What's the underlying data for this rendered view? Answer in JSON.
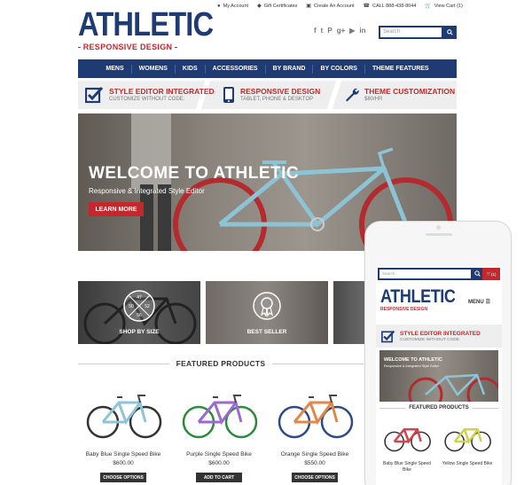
{
  "utility_links": [
    {
      "icon": "user-icon",
      "label": "My Account"
    },
    {
      "icon": "gift-icon",
      "label": "Gift Certificates"
    },
    {
      "icon": "create-account-icon",
      "label": "Create An Account"
    },
    {
      "icon": "phone-icon",
      "label": "CALL 888-438-8044"
    },
    {
      "icon": "cart-icon",
      "label": "View Cart (1)"
    }
  ],
  "logo": {
    "main": "ATHLETIC",
    "sub": "RESPONSIVE DESIGN"
  },
  "social": [
    "facebook-icon",
    "twitter-icon",
    "pinterest-icon",
    "google-plus-icon",
    "youtube-icon",
    "linkedin-icon"
  ],
  "search": {
    "placeholder": "Search"
  },
  "nav": [
    "MENS",
    "WOMENS",
    "KIDS",
    "ACCESSORIES",
    "BY BRAND",
    "BY COLORS",
    "THEME FEATURES"
  ],
  "features": [
    {
      "icon": "checkbox-icon",
      "title": "STYLE EDITOR INTEGRATED",
      "subtitle": "CUSTOMIZE WITHOUT CODE."
    },
    {
      "icon": "tablet-icon",
      "title": "RESPONSIVE DESIGN",
      "subtitle": "TABLET, PHONE & DESKTOP"
    },
    {
      "icon": "wrench-icon",
      "title": "THEME CUSTOMIZATION",
      "subtitle": "$80/HR"
    }
  ],
  "hero": {
    "title": "WELCOME TO ATHLETIC",
    "subtitle": "Responsive & Integrated Style Editor",
    "button": "LEARN MORE"
  },
  "tiles": [
    {
      "label": "SHOP BY SIZE",
      "badge": [
        "47",
        "50",
        "52",
        "56"
      ]
    },
    {
      "label": "BEST SELLER"
    }
  ],
  "featured": {
    "title": "FEATURED PRODUCTS",
    "products": [
      {
        "name": "Baby Blue Single Speed Bike",
        "price": "$600.00",
        "button": "CHOOSE OPTIONS",
        "color": "#8fc3d6"
      },
      {
        "name": "Purple Single Speed Bike",
        "price": "$600.00",
        "button": "ADD TO CART",
        "color": "#9a6ad0"
      },
      {
        "name": "Orange Single Speed Bike",
        "price": "$550.00",
        "button": "CHOOSE OPTIONS",
        "color": "#e0874a"
      }
    ]
  },
  "mobile": {
    "search_placeholder": "Search",
    "cart": "(1)",
    "logo_main": "ATHLETIC",
    "logo_sub": "RESPONSIVE DESIGN",
    "menu": "MENU",
    "feature_title": "STYLE EDITOR INTEGRATED",
    "feature_subtitle": "CUSTOMIZE WITHOUT CODE.",
    "hero_title": "WELCOME TO ATHLETIC",
    "hero_subtitle": "Responsive & Integrated Style Editor",
    "featured_title": "FEATURED PRODUCTS",
    "products": [
      {
        "name": "Baby Blue Single Speed Bike",
        "color": "#d0454b"
      },
      {
        "name": "Yellow Single Speed Bike",
        "color": "#cfd24a"
      }
    ]
  },
  "colors": {
    "brand": "#1f3b74",
    "accent": "#c4282c"
  }
}
